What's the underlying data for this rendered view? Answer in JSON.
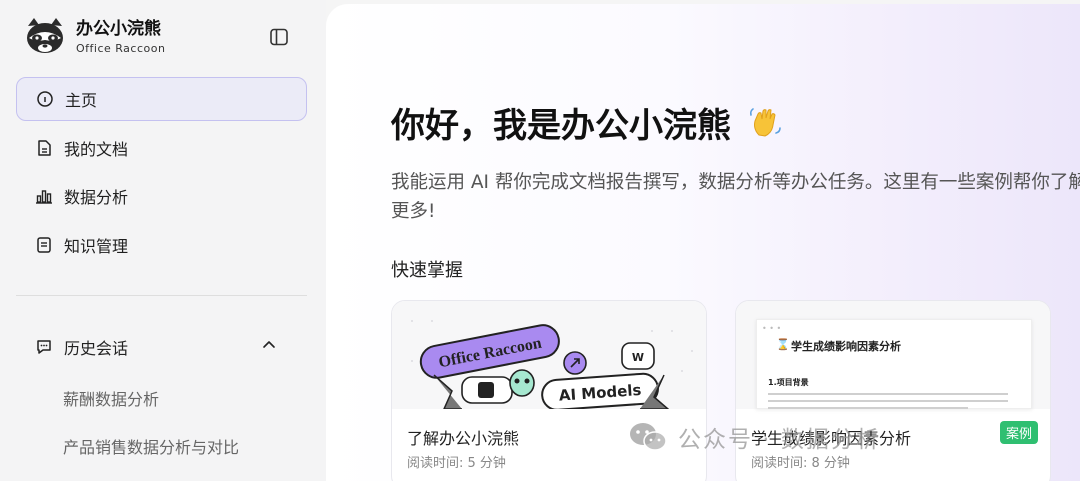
{
  "brand": {
    "title": "办公小浣熊",
    "subtitle": "Office Raccoon"
  },
  "nav": {
    "items": [
      {
        "label": "主页",
        "icon": "home-icon"
      },
      {
        "label": "我的文档",
        "icon": "document-icon"
      },
      {
        "label": "数据分析",
        "icon": "bar-chart-icon"
      },
      {
        "label": "知识管理",
        "icon": "knowledge-icon"
      }
    ]
  },
  "history": {
    "label": "历史会话",
    "items": [
      "薪酬数据分析",
      "产品销售数据分析与对比"
    ]
  },
  "main": {
    "greeting": "你好，我是办公小浣熊",
    "intro": "我能运用 AI 帮你完成文档报告撰写，数据分析等办公任务。这里有一些案例帮你了解更多!",
    "quick_title": "快速掌握"
  },
  "cards": [
    {
      "title": "了解办公小浣熊",
      "time": "阅读时间: 5 分钟",
      "thumb_tag1": "Office Raccoon",
      "thumb_tag2": "AI Models"
    },
    {
      "title": "学生成绩影响因素分析",
      "time": "阅读时间: 8 分钟",
      "badge": "案例",
      "doc_title": "学生成绩影响因素分析",
      "doc_heading": "1.项目背景"
    }
  ],
  "watermark": "公众号 · 数据分析"
}
